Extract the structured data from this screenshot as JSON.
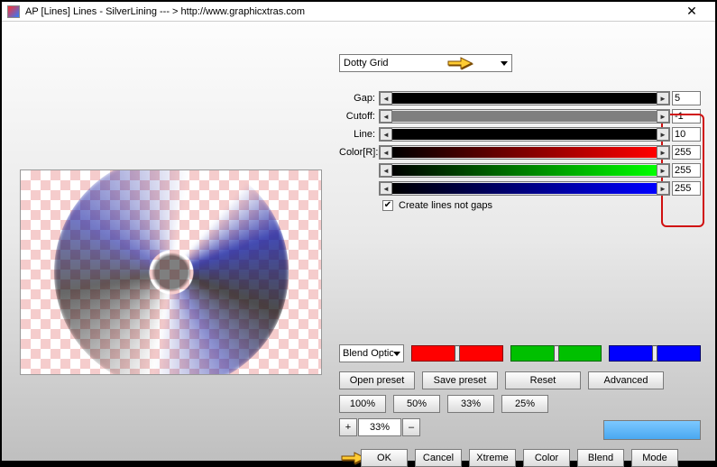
{
  "window": {
    "title": "AP [Lines]  Lines - SilverLining   --- > http://www.graphicxtras.com"
  },
  "preset": {
    "selected": "Dotty Grid"
  },
  "params": {
    "gap": {
      "label": "Gap:",
      "value": "5"
    },
    "cutoff": {
      "label": "Cutoff:",
      "value": "-1"
    },
    "line": {
      "label": "Line:",
      "value": "10"
    },
    "colorR": {
      "label": "Color[R]:",
      "value": "255"
    },
    "colorG": {
      "value": "255"
    },
    "colorB": {
      "value": "255"
    }
  },
  "checkbox": {
    "label": "Create lines not gaps",
    "checked": true
  },
  "blend": {
    "label": "Blend Options"
  },
  "buttons": {
    "open": "Open preset",
    "save": "Save preset",
    "reset": "Reset",
    "adv": "Advanced",
    "p100": "100%",
    "p50": "50%",
    "p33": "33%",
    "p25": "25%",
    "plus": "+",
    "minus": "–",
    "zoomv": "33%",
    "ok": "OK",
    "cancel": "Cancel",
    "xtreme": "Xtreme",
    "color": "Color",
    "blend": "Blend",
    "mode": "Mode"
  }
}
